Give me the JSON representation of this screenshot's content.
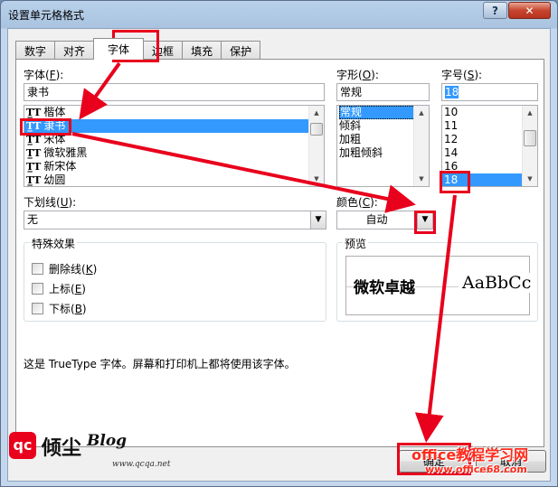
{
  "title": "设置单元格格式",
  "tabs": [
    {
      "label": "数字"
    },
    {
      "label": "对齐"
    },
    {
      "label": "字体"
    },
    {
      "label": "边框"
    },
    {
      "label": "填充"
    },
    {
      "label": "保护"
    }
  ],
  "font": {
    "label": "字体(",
    "key": "F",
    "label_end": "):",
    "value": "隶书",
    "items": [
      {
        "name": "楷体"
      },
      {
        "name": "隶书"
      },
      {
        "name": "宋体"
      },
      {
        "name": "微软雅黑"
      },
      {
        "name": "新宋体"
      },
      {
        "name": "幼圆"
      }
    ]
  },
  "style": {
    "label": "字形(",
    "key": "O",
    "label_end": "):",
    "value": "常规",
    "items": [
      "常规",
      "倾斜",
      "加粗",
      "加粗倾斜"
    ]
  },
  "size": {
    "label": "字号(",
    "key": "S",
    "label_end": "):",
    "value": "18",
    "items": [
      "10",
      "11",
      "12",
      "14",
      "16",
      "18"
    ]
  },
  "underline": {
    "label": "下划线(",
    "key": "U",
    "label_end": "):",
    "value": "无"
  },
  "color": {
    "label": "颜色(",
    "key": "C",
    "label_end": "):",
    "value": "自动"
  },
  "effects": {
    "title": "特殊效果",
    "items": [
      {
        "label": "删除线(",
        "key": "K",
        "label_end": ")"
      },
      {
        "label": "上标(",
        "key": "E",
        "label_end": ")"
      },
      {
        "label": "下标(",
        "key": "B",
        "label_end": ")"
      }
    ]
  },
  "preview": {
    "title": "预览",
    "sample_cn": "微软卓越",
    "sample_en": "AaBbCc"
  },
  "description": "这是 TrueType 字体。屏幕和打印机上都将使用该字体。",
  "buttons": {
    "ok": "确定",
    "cancel": "取消"
  },
  "watermark": {
    "line1": "office教程学习网",
    "line2": "www.office68.com"
  },
  "logo": {
    "mark": "qc",
    "text": "倾尘",
    "blog": "Blog",
    "url": "www.qcqa.net"
  },
  "colors": {
    "selection": "#3399ff",
    "annotation": "#e8001c"
  }
}
